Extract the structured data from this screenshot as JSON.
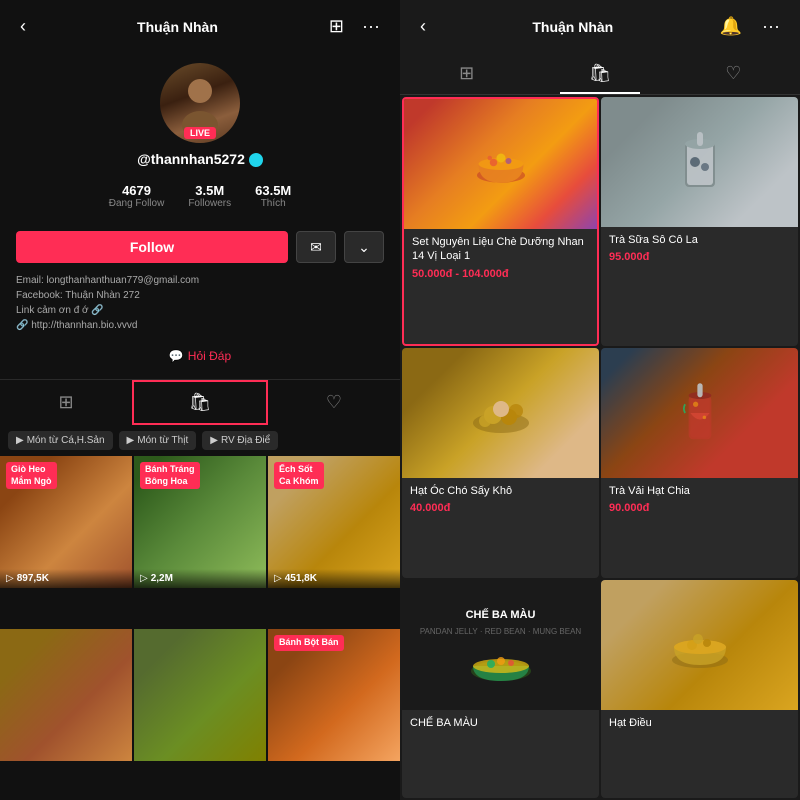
{
  "left": {
    "header": {
      "back_icon": "‹",
      "title": "Thuận Nhàn",
      "bookmark_icon": "⊞",
      "more_icon": "···"
    },
    "profile": {
      "username": "@thannhan5272",
      "live_label": "LIVE",
      "stats": [
        {
          "value": "4679",
          "label": "Đang Follow"
        },
        {
          "value": "3.5M",
          "label": "Followers"
        },
        {
          "value": "63.5M",
          "label": "Thích"
        }
      ],
      "follow_btn": "Follow",
      "bio_lines": [
        "Email: longthanhanthuan779@gmail.com",
        "Facebook: Thuận Nhàn  272",
        "Link cảm ơn đ ớ 🔗",
        "🔗 http://thannhan.bio.vvvd"
      ]
    },
    "hoi_dap": "Hỏi Đáp",
    "tabs": [
      {
        "id": "videos",
        "icon": "⊞"
      },
      {
        "id": "shop",
        "icon": "🛍",
        "active": true
      },
      {
        "id": "saved",
        "icon": "♡"
      }
    ],
    "chips": [
      {
        "label": "Món từ Cá,H.Sản"
      },
      {
        "label": "Món từ Thịt"
      },
      {
        "label": "RV Địa Điể"
      }
    ],
    "videos": [
      {
        "label": "Giò Heo\nMắm Ngò",
        "views": "897,5K",
        "color": "food-img-1"
      },
      {
        "label": "Bánh Tráng\nBông Hoa",
        "views": "2,2M",
        "color": "food-img-2"
      },
      {
        "label": "Ếch Sốt\nCa Khóm",
        "views": "451,8K",
        "color": "food-img-3"
      },
      {
        "label": "",
        "views": "",
        "color": "food-img-4"
      },
      {
        "label": "",
        "views": "",
        "color": "food-img-5"
      },
      {
        "label": "Bánh Bột Bán",
        "views": "",
        "color": "food-img-6"
      }
    ]
  },
  "right": {
    "header": {
      "back_icon": "‹",
      "title": "Thuận Nhàn",
      "bell_icon": "🔔",
      "more_icon": "···"
    },
    "tabs": [
      {
        "id": "grid",
        "icon": "⊞"
      },
      {
        "id": "shop",
        "icon": "🛍",
        "active": true
      },
      {
        "id": "saved",
        "icon": "♡"
      }
    ],
    "products": [
      {
        "id": "p1",
        "name": "Set Nguyên Liệu Chè Dưỡng Nhan 14 Vị Loại 1",
        "price": "50.000đ - 104.000đ",
        "selected": true,
        "img_type": "bowl"
      },
      {
        "id": "p2",
        "name": "Trà Sữa Sô Cô La",
        "price": "95.000đ",
        "selected": false,
        "img_type": "drink"
      },
      {
        "id": "p3",
        "name": "Hạt Óc Chó Sấy Khô",
        "price": "40.000đ",
        "selected": false,
        "img_type": "nuts"
      },
      {
        "id": "p4",
        "name": "Trà Vải Hạt Chia",
        "price": "90.000đ",
        "selected": false,
        "img_type": "cold-drink"
      },
      {
        "id": "p5",
        "name": "CHẾ BA MÀU",
        "price": "",
        "selected": false,
        "img_type": "che-ba-mau"
      },
      {
        "id": "p6",
        "name": "Hạt Điều",
        "price": "",
        "selected": false,
        "img_type": "cashew"
      }
    ]
  }
}
